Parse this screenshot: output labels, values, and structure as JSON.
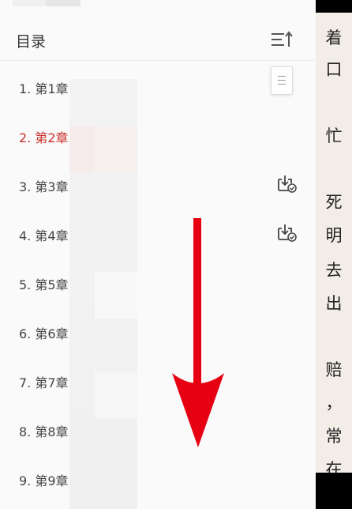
{
  "header": {
    "title": "目录"
  },
  "chapters": [
    {
      "label": "1. 第1章",
      "status": "normal"
    },
    {
      "label": "2. 第2章",
      "status": "active"
    },
    {
      "label": "3. 第3章",
      "status": "downloaded"
    },
    {
      "label": "4. 第4章",
      "status": "downloaded"
    },
    {
      "label": "5. 第5章",
      "status": "normal"
    },
    {
      "label": "6. 第6章",
      "status": "normal"
    },
    {
      "label": "7. 第7章",
      "status": "normal"
    },
    {
      "label": "8. 第8章",
      "status": "normal"
    },
    {
      "label": "9. 第9章",
      "status": "normal"
    }
  ],
  "reader_chars": [
    "着",
    "口",
    "忙",
    "死",
    "明",
    "去",
    "出",
    "赔",
    "，",
    "常",
    "在"
  ],
  "colors": {
    "active": "#c9302c",
    "arrow": "#e60012",
    "text": "#444444"
  },
  "icons": {
    "sort": "sort-icon",
    "download": "download-done-icon",
    "float": "bookmark-icon"
  }
}
